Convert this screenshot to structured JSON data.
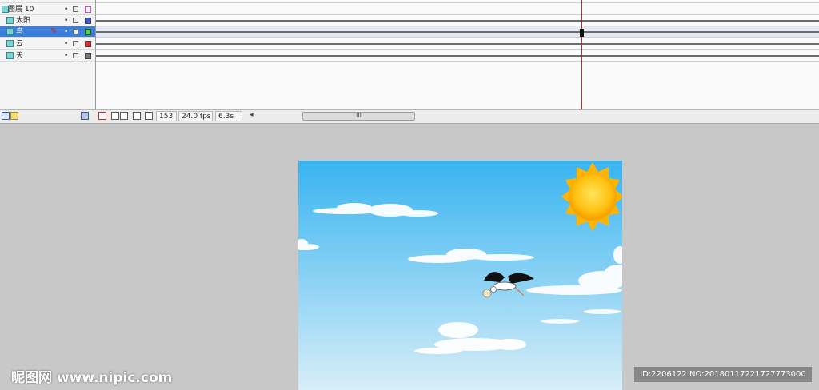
{
  "layers": [
    {
      "name": "图层 10",
      "color": "#d244d8",
      "indent": false,
      "selected": false
    },
    {
      "name": "太阳",
      "color": "#3f55d8",
      "indent": true,
      "selected": false
    },
    {
      "name": "鸟",
      "color": "#4cd84c",
      "indent": true,
      "selected": true
    },
    {
      "name": "云",
      "color": "#d83434",
      "indent": true,
      "selected": false
    },
    {
      "name": "天",
      "color": "#7a7a7a",
      "indent": true,
      "selected": false
    }
  ],
  "toolbar": {
    "frame": "153",
    "fps": "24.0 fps",
    "time": "6.3s",
    "scroll_grip": "III"
  },
  "watermark": {
    "left": "昵图网 www.nipic.com",
    "right": "ID:2206122 NO:20180117221727773000"
  },
  "colors": {
    "sky_top": "#38b4f0",
    "sky_bottom": "#d8eef8",
    "sun": "#ffc41a",
    "playhead": "#d32020",
    "selected_layer": "#3c7fd8"
  }
}
